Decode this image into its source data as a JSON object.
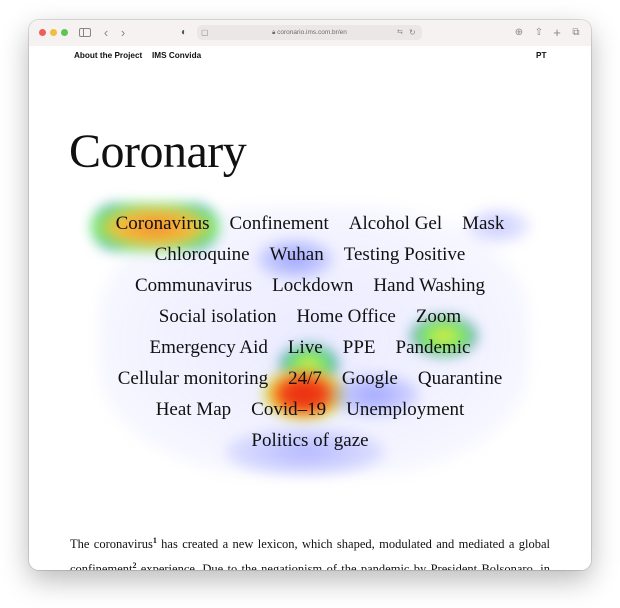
{
  "browser": {
    "url": "coronario.ims.com.br/en",
    "icons": [
      "close-dot",
      "minimize-dot",
      "zoom-dot",
      "sidebar-icon",
      "back-icon",
      "forward-icon",
      "privacy-shield-icon",
      "reader-icon",
      "lock-icon",
      "translate-icon",
      "reload-icon",
      "download-icon",
      "share-icon",
      "new-tab-icon",
      "tabs-overview-icon"
    ]
  },
  "nav": {
    "about": "About the Project",
    "convida": "IMS Convida",
    "lang": "PT"
  },
  "page_title": "Coronary",
  "word_cloud": {
    "rows": [
      [
        "Coronavirus",
        "Confinement",
        "Alcohol Gel",
        "Mask"
      ],
      [
        "Chloroquine",
        "Wuhan",
        "Testing Positive"
      ],
      [
        "Communavirus",
        "Lockdown",
        "Hand Washing"
      ],
      [
        "Social isolation",
        "Home Office",
        "Zoom"
      ],
      [
        "Emergency Aid",
        "Live",
        "PPE",
        "Pandemic"
      ],
      [
        "Cellular monitoring",
        "24/7",
        "Google",
        "Quarantine"
      ],
      [
        "Heat Map",
        "Covid–19",
        "Unemployment"
      ],
      [
        "Politics of gaze"
      ]
    ],
    "heat_colors": {
      "low": "#7f86ff",
      "mid": "#3ee07a",
      "high": "#ffe23a",
      "peak": "#f02a10"
    }
  },
  "intro": {
    "text_before_1": "The coronavirus",
    "sup1": "1",
    "text_mid": " has created a new lexicon, which shaped, modulated and mediated a global confinement",
    "sup2": "2",
    "text_after": " experience. Due to the negationism of the pandemic by President Bolsonaro, in Brazil it gains particular features, while maintaining a dialogue with the"
  }
}
